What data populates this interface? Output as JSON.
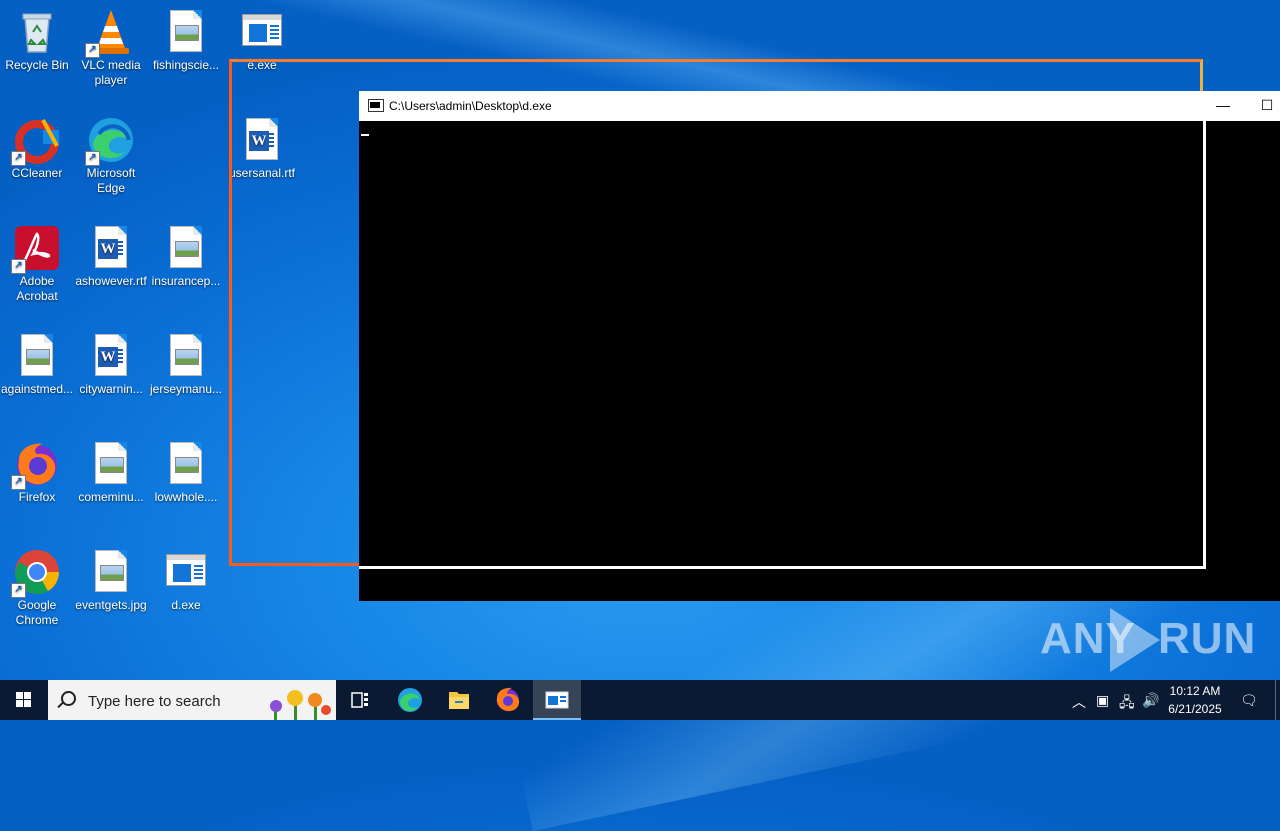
{
  "desktop": {
    "icons": [
      {
        "label": "Recycle Bin",
        "icon": "recycle-bin-icon"
      },
      {
        "label": "VLC media player",
        "icon": "vlc-icon"
      },
      {
        "label": "fishingscie...",
        "icon": "image-file-icon"
      },
      {
        "label": "e.exe",
        "icon": "exe-file-icon"
      },
      {
        "label": "CCleaner",
        "icon": "ccleaner-icon"
      },
      {
        "label": "Microsoft Edge",
        "icon": "edge-icon"
      },
      {
        "label": "usersanal.rtf",
        "icon": "word-file-icon"
      },
      {
        "label": "Adobe Acrobat",
        "icon": "acrobat-icon"
      },
      {
        "label": "ashowever.rtf",
        "icon": "word-file-icon"
      },
      {
        "label": "insurancep...",
        "icon": "image-file-icon"
      },
      {
        "label": "againstmed...",
        "icon": "image-file-icon"
      },
      {
        "label": "citywarnin...",
        "icon": "word-file-icon"
      },
      {
        "label": "jerseymanu...",
        "icon": "image-file-icon"
      },
      {
        "label": "Firefox",
        "icon": "firefox-icon"
      },
      {
        "label": "comeminu...",
        "icon": "image-file-icon"
      },
      {
        "label": "lowwhole....",
        "icon": "image-file-icon"
      },
      {
        "label": "Google Chrome",
        "icon": "chrome-icon"
      },
      {
        "label": "eventgets.jpg",
        "icon": "image-file-icon"
      },
      {
        "label": "d.exe",
        "icon": "exe-file-icon"
      }
    ]
  },
  "console": {
    "title": "C:\\Users\\admin\\Desktop\\d.exe",
    "minimize": "—",
    "maximize": "☐"
  },
  "watermark": {
    "left": "ANY",
    "right": "RUN"
  },
  "taskbar": {
    "search_placeholder": "Type here to search",
    "items": [
      "task-view",
      "edge",
      "file-explorer",
      "firefox",
      "console"
    ],
    "clock_time": "10:12 AM",
    "clock_date": "6/21/2025"
  },
  "colors": {
    "accent": "#0a6fd6",
    "selection_orange": "#ff5a1a",
    "taskbar": "#0b1a33"
  }
}
